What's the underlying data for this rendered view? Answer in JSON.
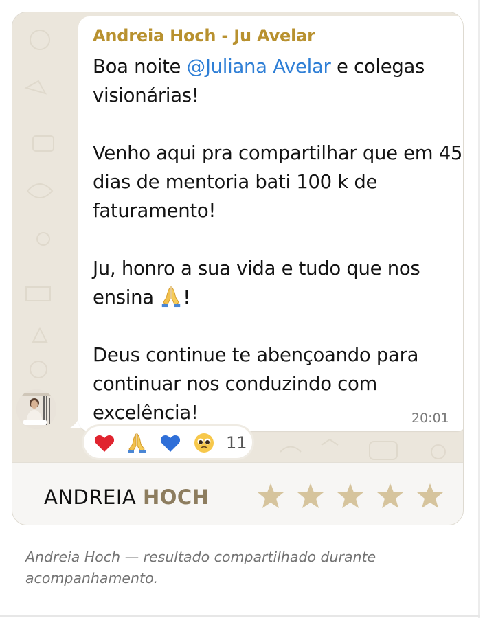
{
  "message": {
    "sender": "Andreia Hoch - Ju Avelar",
    "greeting_start": "Boa noite ",
    "mention": "@Juliana Avelar",
    "greeting_end": " e colegas visionárias!",
    "paragraph2": "Venho aqui pra compartilhar que em 45 dias de mentoria bati 100 k de faturamento!",
    "paragraph3_start": "Ju, honro a sua vida e tudo que nos ensina ",
    "paragraph3_end": "!",
    "paragraph3_emoji": "praying-hands-icon",
    "paragraph4": "Deus continue te abençoando para continuar nos conduzindo com excelência!",
    "time": "20:01"
  },
  "reactions": {
    "icons": [
      "heart-icon",
      "praying-hands-icon",
      "blue-heart-icon",
      "pleading-face-icon"
    ],
    "count": "11"
  },
  "footer": {
    "first_name": "ANDREIA",
    "last_name": "HOCH",
    "rating": 5,
    "rating_max": 5
  },
  "caption": "Andreia Hoch — resultado compartilhado durante acompanhamento.",
  "colors": {
    "sender": "#b8912f",
    "mention": "#2f7fd6",
    "star": "#d6c49d",
    "last_name": "#8d7d5f",
    "chat_background": "#ebe6dc"
  }
}
